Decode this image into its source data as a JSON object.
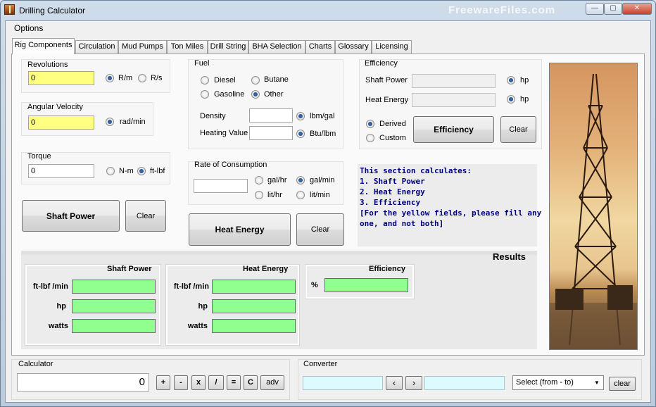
{
  "window": {
    "title": "Drilling Calculator",
    "watermark": "FreewareFiles.com",
    "controls": {
      "minimize": "—",
      "maximize": "▢",
      "close": "✕"
    }
  },
  "menu": {
    "options": "Options"
  },
  "tabs": [
    "Rig Components",
    "Circulation",
    "Mud Pumps",
    "Ton Miles",
    "Drill String",
    "BHA Selection",
    "Charts",
    "Glossary",
    "Licensing"
  ],
  "revolutions": {
    "label": "Revolutions",
    "value": "0",
    "opt1": "R/m",
    "opt2": "R/s"
  },
  "angular": {
    "label": "Angular Velocity",
    "value": "0",
    "opt1": "rad/min"
  },
  "torque": {
    "label": "Torque",
    "value": "0",
    "opt1": "N-m",
    "opt2": "ft-lbf"
  },
  "shaft_buttons": {
    "shaft_power": "Shaft Power",
    "clear": "Clear"
  },
  "fuel": {
    "label": "Fuel",
    "diesel": "Diesel",
    "butane": "Butane",
    "gasoline": "Gasoline",
    "other": "Other",
    "density": "Density",
    "density_unit": "lbm/gal",
    "heating_value": "Heating Value",
    "heating_unit": "Btu/lbm"
  },
  "consumption": {
    "label": "Rate of Consumption",
    "u1": "gal/hr",
    "u2": "gal/min",
    "u3": "lit/hr",
    "u4": "lit/min"
  },
  "heat_buttons": {
    "heat_energy": "Heat Energy",
    "clear": "Clear"
  },
  "efficiency": {
    "label": "Efficiency",
    "shaft_power": "Shaft Power",
    "heat_energy": "Heat Energy",
    "hp1": "hp",
    "hp2": "hp",
    "derived": "Derived",
    "custom": "Custom",
    "button": "Efficiency",
    "clear": "Clear"
  },
  "info": {
    "lines": [
      "This section calculates:",
      "1. Shaft Power",
      "2. Heat Energy",
      "3. Efficiency",
      "",
      "[For the yellow fields, please fill any",
      "one, and not both]"
    ]
  },
  "results": {
    "title": "Results",
    "shaft_power": {
      "title": "Shaft Power",
      "rows": [
        "ft-lbf /min",
        "hp",
        "watts"
      ]
    },
    "heat_energy": {
      "title": "Heat Energy",
      "rows": [
        "ft-lbf /min",
        "hp",
        "watts"
      ]
    },
    "efficiency": {
      "title": "Efficiency",
      "row": "%"
    }
  },
  "calculator": {
    "label": "Calculator",
    "display": "0",
    "keys": [
      "+",
      "-",
      "x",
      "/",
      "=",
      "C",
      "adv"
    ]
  },
  "converter": {
    "label": "Converter",
    "prev": "‹",
    "next": "›",
    "select": "Select (from - to)",
    "clear": "clear"
  }
}
